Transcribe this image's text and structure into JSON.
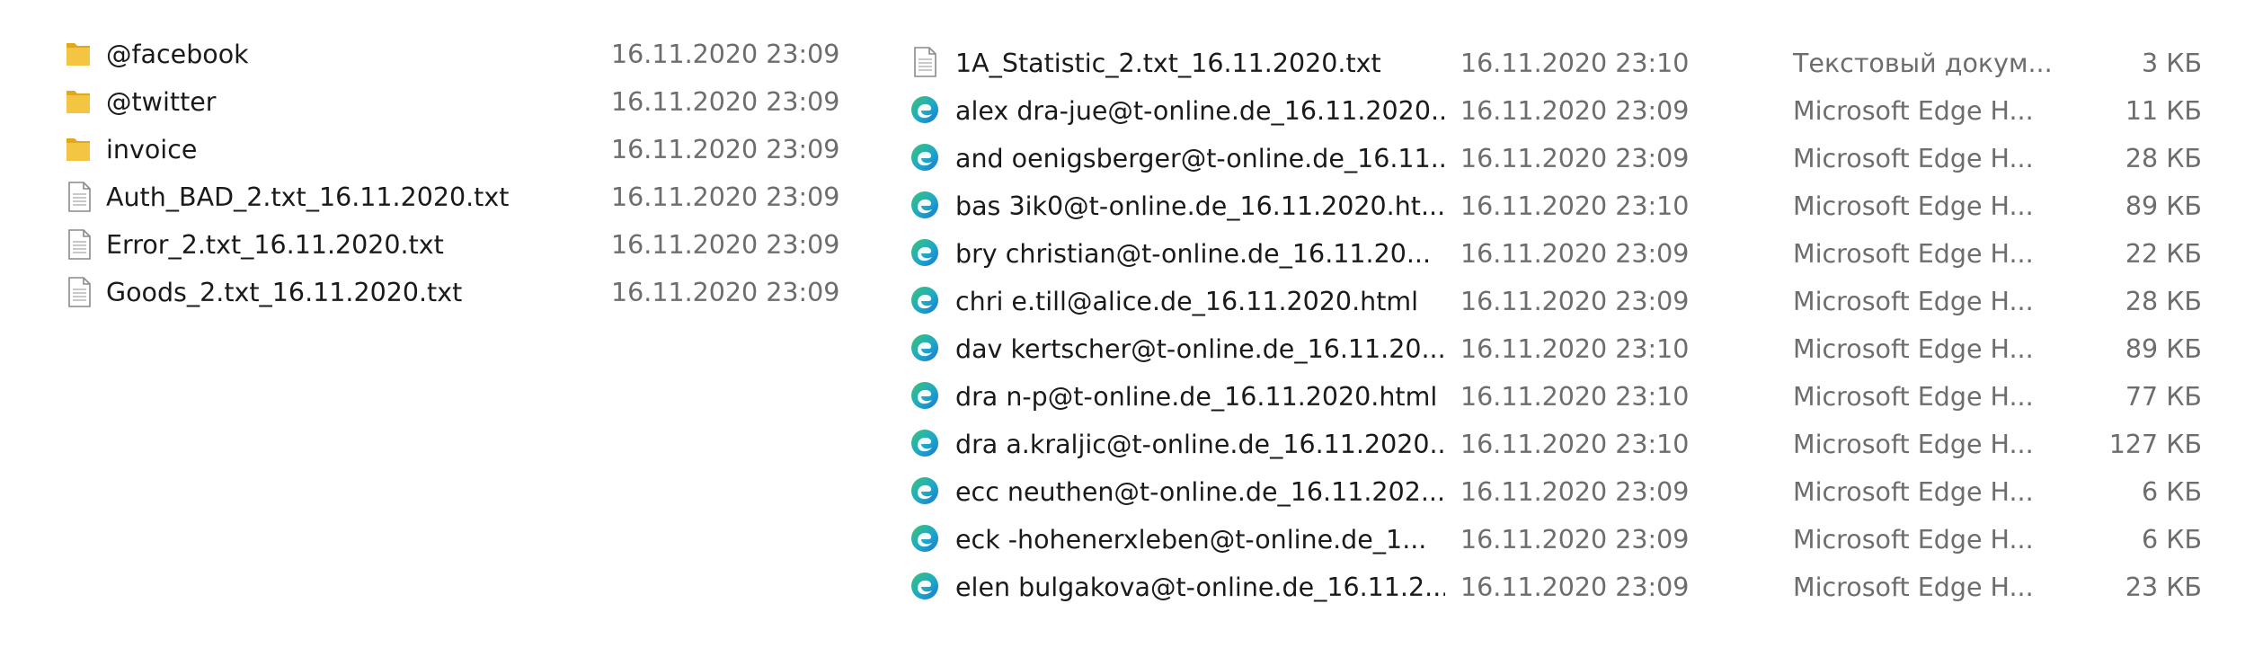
{
  "left_pane": {
    "items": [
      {
        "icon": "folder-icon",
        "name": "@facebook",
        "date": "16.11.2020 23:09"
      },
      {
        "icon": "folder-icon",
        "name": "@twitter",
        "date": "16.11.2020 23:09"
      },
      {
        "icon": "folder-icon",
        "name": "invoice",
        "date": "16.11.2020 23:09"
      },
      {
        "icon": "text-file-icon",
        "name": "Auth_BAD_2.txt_16.11.2020.txt",
        "date": "16.11.2020 23:09"
      },
      {
        "icon": "text-file-icon",
        "name": "Error_2.txt_16.11.2020.txt",
        "date": "16.11.2020 23:09"
      },
      {
        "icon": "text-file-icon",
        "name": "Goods_2.txt_16.11.2020.txt",
        "date": "16.11.2020 23:09"
      }
    ]
  },
  "right_pane": {
    "items": [
      {
        "icon": "text-file-icon",
        "name": "1A_Statistic_2.txt_16.11.2020.txt",
        "date": "16.11.2020 23:10",
        "type": "Текстовый докум...",
        "size": "3 КБ"
      },
      {
        "icon": "edge-icon",
        "name": "alex    dra-jue@t-online.de_16.11.2020...",
        "date": "16.11.2020 23:09",
        "type": "Microsoft Edge H...",
        "size": "11 КБ"
      },
      {
        "icon": "edge-icon",
        "name": "and    oenigsberger@t-online.de_16.11...",
        "date": "16.11.2020 23:09",
        "type": "Microsoft Edge H...",
        "size": "28 КБ"
      },
      {
        "icon": "edge-icon",
        "name": "bas    3ik0@t-online.de_16.11.2020.ht...",
        "date": "16.11.2020 23:10",
        "type": "Microsoft Edge H...",
        "size": "89 КБ"
      },
      {
        "icon": "edge-icon",
        "name": "bry    christian@t-online.de_16.11.20...",
        "date": "16.11.2020 23:09",
        "type": "Microsoft Edge H...",
        "size": "22 КБ"
      },
      {
        "icon": "edge-icon",
        "name": "chri    e.till@alice.de_16.11.2020.html",
        "date": "16.11.2020 23:09",
        "type": "Microsoft Edge H...",
        "size": "28 КБ"
      },
      {
        "icon": "edge-icon",
        "name": "dav    kertscher@t-online.de_16.11.20...",
        "date": "16.11.2020 23:10",
        "type": "Microsoft Edge H...",
        "size": "89 КБ"
      },
      {
        "icon": "edge-icon",
        "name": "dra    n-p@t-online.de_16.11.2020.html",
        "date": "16.11.2020 23:10",
        "type": "Microsoft Edge H...",
        "size": "77 КБ"
      },
      {
        "icon": "edge-icon",
        "name": "dra    a.kraljic@t-online.de_16.11.2020....",
        "date": "16.11.2020 23:10",
        "type": "Microsoft Edge H...",
        "size": "127 КБ"
      },
      {
        "icon": "edge-icon",
        "name": "ecc    neuthen@t-online.de_16.11.202...",
        "date": "16.11.2020 23:09",
        "type": "Microsoft Edge H...",
        "size": "6 КБ"
      },
      {
        "icon": "edge-icon",
        "name": "eck    -hohenerxleben@t-online.de_1...",
        "date": "16.11.2020 23:09",
        "type": "Microsoft Edge H...",
        "size": "6 КБ"
      },
      {
        "icon": "edge-icon",
        "name": "elen    bulgakova@t-online.de_16.11.2...",
        "date": "16.11.2020 23:09",
        "type": "Microsoft Edge H...",
        "size": "23 КБ"
      }
    ]
  },
  "colors": {
    "folder": "#f4c542",
    "folder_dark": "#e0a81c",
    "edge_blue": "#1877d2",
    "edge_green": "#3cc474",
    "text_primary": "#1a1a1a",
    "text_secondary": "#6d6d6d"
  }
}
